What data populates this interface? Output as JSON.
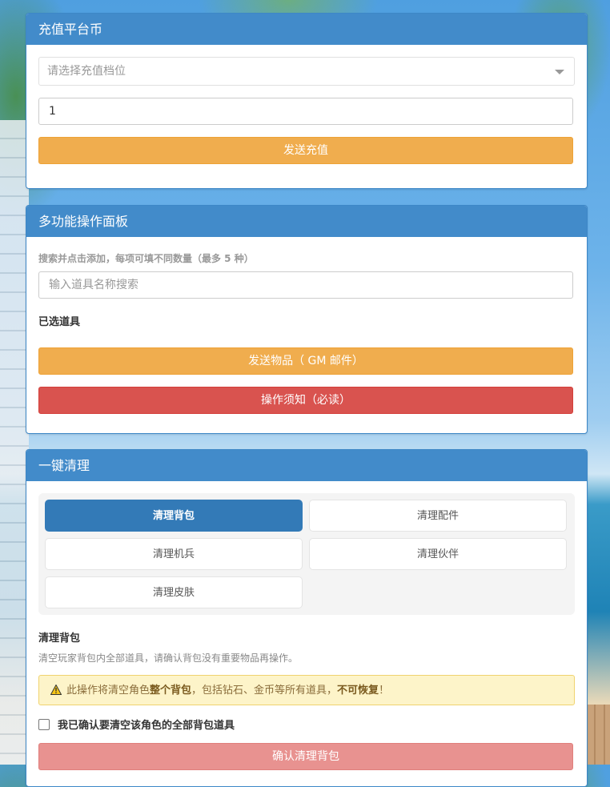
{
  "recharge": {
    "title": "充值平台币",
    "tier_placeholder": "请选择充值档位",
    "amount_value": "1",
    "send_button": "发送充值"
  },
  "multi": {
    "title": "多功能操作面板",
    "hint": "搜索并点击添加，每项可填不同数量（最多 5 种）",
    "search_placeholder": "输入道具名称搜索",
    "selected_label": "已选道具",
    "send_items_button": "发送物品（ GM 邮件）",
    "notice_button": "操作须知（必读）"
  },
  "clear": {
    "title": "一键清理",
    "tabs": [
      {
        "label": "清理背包",
        "active": true
      },
      {
        "label": "清理配件",
        "active": false
      },
      {
        "label": "清理机兵",
        "active": false
      },
      {
        "label": "清理伙伴",
        "active": false
      },
      {
        "label": "清理皮肤",
        "active": false
      }
    ],
    "section_title": "清理背包",
    "section_desc": "清空玩家背包内全部道具，请确认背包没有重要物品再操作。",
    "warning": {
      "pre": "此操作将清空角色",
      "bold1": "整个背包",
      "mid": "，包括钻石、金币等所有道具，",
      "bold2": "不可恢复",
      "post": "！"
    },
    "confirm_checkbox_label": "我已确认要清空该角色的全部背包道具",
    "confirm_button": "确认清理背包"
  },
  "colors": {
    "panel_header": "#428bca",
    "warning_button": "#f0ad4e",
    "danger_button": "#d9534f",
    "tab_active": "#337ab7"
  }
}
